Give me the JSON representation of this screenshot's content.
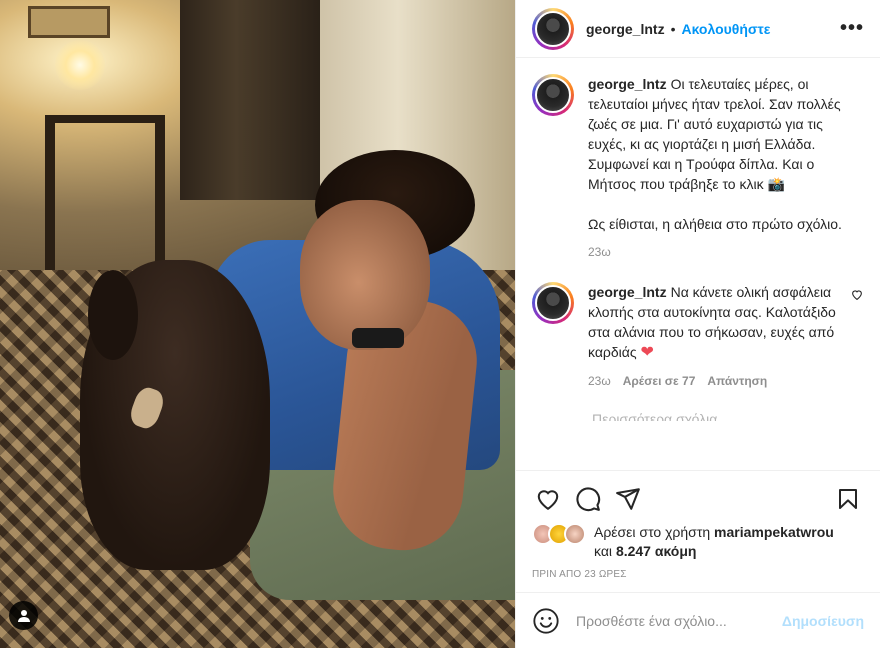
{
  "post": {
    "author": "george_lntz",
    "follow_label": "Ακολουθήστε",
    "dot": "•",
    "more_icon": "more-horizontal-icon",
    "more_glyph": "•••"
  },
  "caption": {
    "username": "george_lntz",
    "text": "Οι τελευταίες μέρες, οι τελευταίοι μήνες ήταν τρελοί. Σαν πολλές ζωές σε μια. Γι' αυτό ευχαριστώ για τις ευχές, κι ας γιορτάζει η μισή Ελλάδα. Συμφωνεί και η Τρούφα δίπλα. Και ο Μήτσος που τράβηξε το κλικ 📸\n\nΩς είθισται, η αλήθεια στο πρώτο σχόλιο.",
    "time": "23ω"
  },
  "comment": {
    "username": "george_lntz",
    "text": "Να κάνετε ολική ασφάλεια κλοπής στα αυτοκίνητα σας. Καλοτάξιδο στα αλάνια που το σήκωσαν, ευχές από καρδιάς",
    "emoji": "❤",
    "time": "23ω",
    "likes": "Αρέσει σε 77",
    "reply": "Απάντηση"
  },
  "next_comment_fragment": "Περισσότερα σχόλια...",
  "actions": {
    "like_icon": "heart-icon",
    "comment_icon": "comment-icon",
    "share_icon": "send-icon",
    "save_icon": "bookmark-icon"
  },
  "likes": {
    "prefix": "Αρέσει στο χρήστη",
    "user": "mariampekatwrou",
    "and": "και",
    "count": "8.247 ακόμη"
  },
  "timestamp": "ΠΡΙΝ ΑΠΟ 23 ΩΡΕΣ",
  "add_comment": {
    "placeholder": "Προσθέστε ένα σχόλιο...",
    "post_label": "Δημοσίευση",
    "emoji_icon": "smiley-icon"
  },
  "colors": {
    "link": "#0095f6",
    "post_disabled": "#b2dffc",
    "secondary": "#8e8e8e",
    "like_red": "#ed4956"
  }
}
